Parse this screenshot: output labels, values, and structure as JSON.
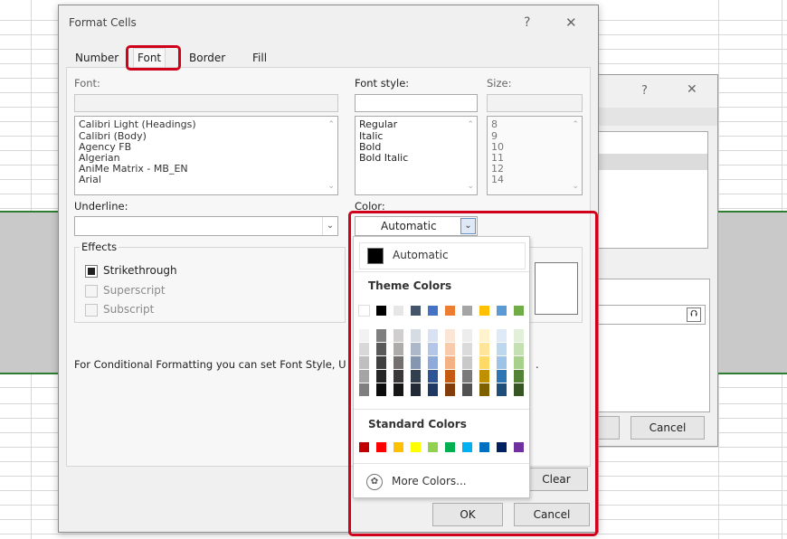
{
  "dialog": {
    "title": "Format Cells",
    "help": "?",
    "close": "✕",
    "tabs": [
      "Number",
      "Font",
      "Border",
      "Fill"
    ]
  },
  "back_dialog": {
    "help": "?",
    "close": "✕",
    "cancel": "Cancel",
    "upload_icon": "⮉"
  },
  "font": {
    "label": "Font:",
    "items": [
      "Calibri Light (Headings)",
      "Calibri (Body)",
      "Agency FB",
      "Algerian",
      "AniMe Matrix - MB_EN",
      "Arial"
    ]
  },
  "font_style": {
    "label": "Font style:",
    "items": [
      "Regular",
      "Italic",
      "Bold",
      "Bold Italic"
    ]
  },
  "size": {
    "label": "Size:",
    "items": [
      "8",
      "9",
      "10",
      "11",
      "12",
      "14"
    ]
  },
  "underline": {
    "label": "Underline:"
  },
  "color": {
    "label": "Color:",
    "value": "Automatic"
  },
  "effects": {
    "label": "Effects",
    "strikethrough": "Strikethrough",
    "superscript": "Superscript",
    "subscript": "Subscript"
  },
  "note": "For Conditional Formatting you can set Font Style, U",
  "note_tail": ".",
  "buttons": {
    "clear": "Clear",
    "ok": "OK",
    "cancel": "Cancel"
  },
  "color_popup": {
    "automatic": "Automatic",
    "theme_title": "Theme Colors",
    "standard_title": "Standard Colors",
    "more_colors": "More Colors...",
    "theme_top": [
      "#ffffff",
      "#000000",
      "#e7e6e6",
      "#44546a",
      "#4472c4",
      "#ed7d31",
      "#a5a5a5",
      "#ffc000",
      "#5b9bd5",
      "#70ad47"
    ],
    "theme_shades": [
      [
        "#f2f2f2",
        "#d8d8d8",
        "#bfbfbf",
        "#a5a5a5",
        "#7f7f7f"
      ],
      [
        "#7f7f7f",
        "#595959",
        "#3f3f3f",
        "#262626",
        "#0c0c0c"
      ],
      [
        "#d0cece",
        "#aeabab",
        "#757070",
        "#3a3838",
        "#161616"
      ],
      [
        "#d6dce4",
        "#adb9ca",
        "#8496b0",
        "#323f4f",
        "#222a35"
      ],
      [
        "#d9e2f3",
        "#b4c6e7",
        "#8eaadb",
        "#2f5496",
        "#1f3864"
      ],
      [
        "#fbe5d5",
        "#f7cbac",
        "#f4b183",
        "#c55a11",
        "#833c0b"
      ],
      [
        "#ededed",
        "#dbdbdb",
        "#c9c9c9",
        "#7b7b7b",
        "#525252"
      ],
      [
        "#fff2cc",
        "#fee599",
        "#ffd965",
        "#bf9000",
        "#7f6000"
      ],
      [
        "#deebf6",
        "#bdd7ee",
        "#9dc3e6",
        "#2e75b5",
        "#1e4e79"
      ],
      [
        "#e2efd9",
        "#c5e0b3",
        "#a8d08d",
        "#538135",
        "#375623"
      ]
    ],
    "standard": [
      "#c00000",
      "#ff0000",
      "#ffc000",
      "#ffff00",
      "#92d050",
      "#00b050",
      "#00b0f0",
      "#0070c0",
      "#002060",
      "#7030a0"
    ]
  },
  "colors": {
    "highlight": "#d0021b",
    "band": "#c9c9c9",
    "band_border": "#2e7d32"
  }
}
